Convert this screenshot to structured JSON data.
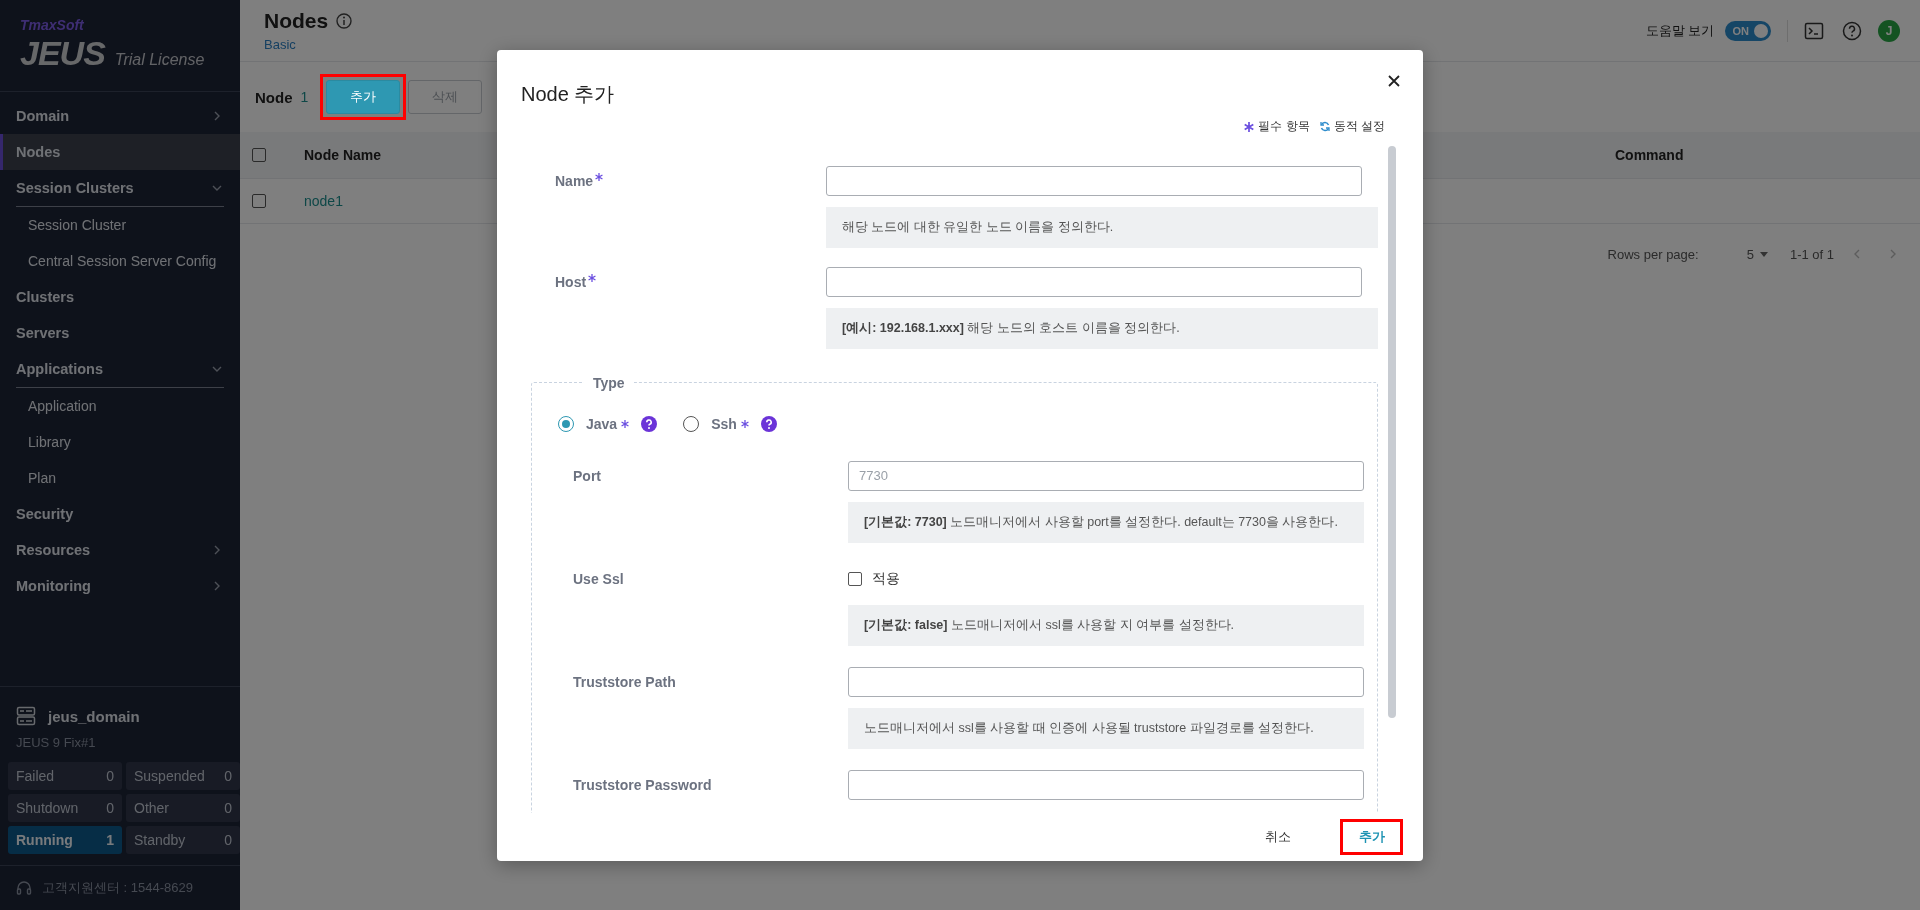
{
  "sidebar": {
    "logo": {
      "brand": "TmaxSoft",
      "product": "JEUS",
      "edition": "Trial License"
    },
    "menu": [
      {
        "label": "Domain",
        "selected": false,
        "expanded": false
      },
      {
        "label": "Nodes",
        "selected": true
      },
      {
        "label": "Session Clusters",
        "selected": false,
        "expanded": true,
        "children": [
          {
            "label": "Session Cluster",
            "selected": false
          },
          {
            "label": "Central Session Server Config",
            "selected": false
          }
        ]
      },
      {
        "label": "Clusters",
        "selected": false
      },
      {
        "label": "Servers",
        "selected": false
      },
      {
        "label": "Applications",
        "selected": false,
        "expanded": true,
        "children": [
          {
            "label": "Application",
            "selected": false
          },
          {
            "label": "Library",
            "selected": false
          },
          {
            "label": "Plan",
            "selected": false
          }
        ]
      },
      {
        "label": "Security",
        "selected": false
      },
      {
        "label": "Resources",
        "selected": false,
        "expanded": false
      },
      {
        "label": "Monitoring",
        "selected": false,
        "expanded": false
      }
    ],
    "domain": {
      "name": "jeus_domain",
      "version": "JEUS 9 Fix#1"
    },
    "stats": [
      {
        "label": "Failed",
        "count": "0",
        "active": false
      },
      {
        "label": "Suspended",
        "count": "0",
        "active": false
      },
      {
        "label": "Shutdown",
        "count": "0",
        "active": false
      },
      {
        "label": "Other",
        "count": "0",
        "active": false
      },
      {
        "label": "Running",
        "count": "1",
        "active": true
      },
      {
        "label": "Standby",
        "count": "0",
        "active": false
      }
    ],
    "support": "고객지원센터 : 1544-8629"
  },
  "header": {
    "title": "Nodes",
    "subtitle": "Basic",
    "help_label": "도움말 보기",
    "help_toggle": {
      "label": "ON",
      "on": true
    },
    "avatar": "J"
  },
  "toolbar": {
    "label": "Node",
    "count": "1",
    "buttons": [
      {
        "label": "추가",
        "disabled": false,
        "highlighted": true
      },
      {
        "label": "삭제",
        "disabled": true,
        "highlighted": false
      }
    ]
  },
  "table": {
    "select_all": {
      "checked": false
    },
    "columns": [
      "Node Name",
      "Command"
    ],
    "rows": [
      {
        "name": "node1",
        "checked": false
      }
    ]
  },
  "pagination": {
    "rows_per_page_label": "Rows per page:",
    "rows_per_page": "5",
    "range": "1-1 of 1"
  },
  "dialog": {
    "title": "Node 추가",
    "legend": [
      {
        "kind": "required",
        "label": "필수 항목"
      },
      {
        "kind": "dynamic",
        "label": "동적 설정"
      }
    ],
    "fields": [
      {
        "kind": "text",
        "label": "Name",
        "required": true,
        "hint": "해당 노드에 대한 유일한 노드 이름을 정의한다."
      },
      {
        "kind": "text",
        "label": "Host",
        "required": true,
        "hint": "**[예시: 192.168.1.xxx]** 해당 노드의 호스트 이름을 정의한다."
      }
    ],
    "type_group": {
      "title": "Type",
      "options": [
        {
          "label": "Java",
          "required": true,
          "selected": true
        },
        {
          "label": "Ssh",
          "required": true,
          "selected": false
        }
      ],
      "fields": [
        {
          "kind": "text",
          "label": "Port",
          "required": false,
          "placeholder": "7730",
          "hint": "**[기본값: 7730]** 노드매니저에서 사용할 port를 설정한다. default는 7730을 사용한다."
        },
        {
          "kind": "checkbox",
          "label": "Use Ssl",
          "required": false,
          "option": "적용",
          "checked": false,
          "hint": "**[기본값: false]** 노드매니저에서 ssl를 사용할 지 여부를 설정한다."
        },
        {
          "kind": "text",
          "label": "Truststore Path",
          "required": false,
          "hint": "노드매니저에서 ssl를 사용할 때 인증에 사용될 truststore 파일경로를 설정한다."
        },
        {
          "kind": "password",
          "label": "Truststore Password",
          "required": false
        }
      ]
    },
    "buttons": [
      {
        "kind": "cancel",
        "label": "취소",
        "highlighted": false
      },
      {
        "kind": "confirm",
        "label": "추가",
        "highlighted": true
      }
    ]
  }
}
